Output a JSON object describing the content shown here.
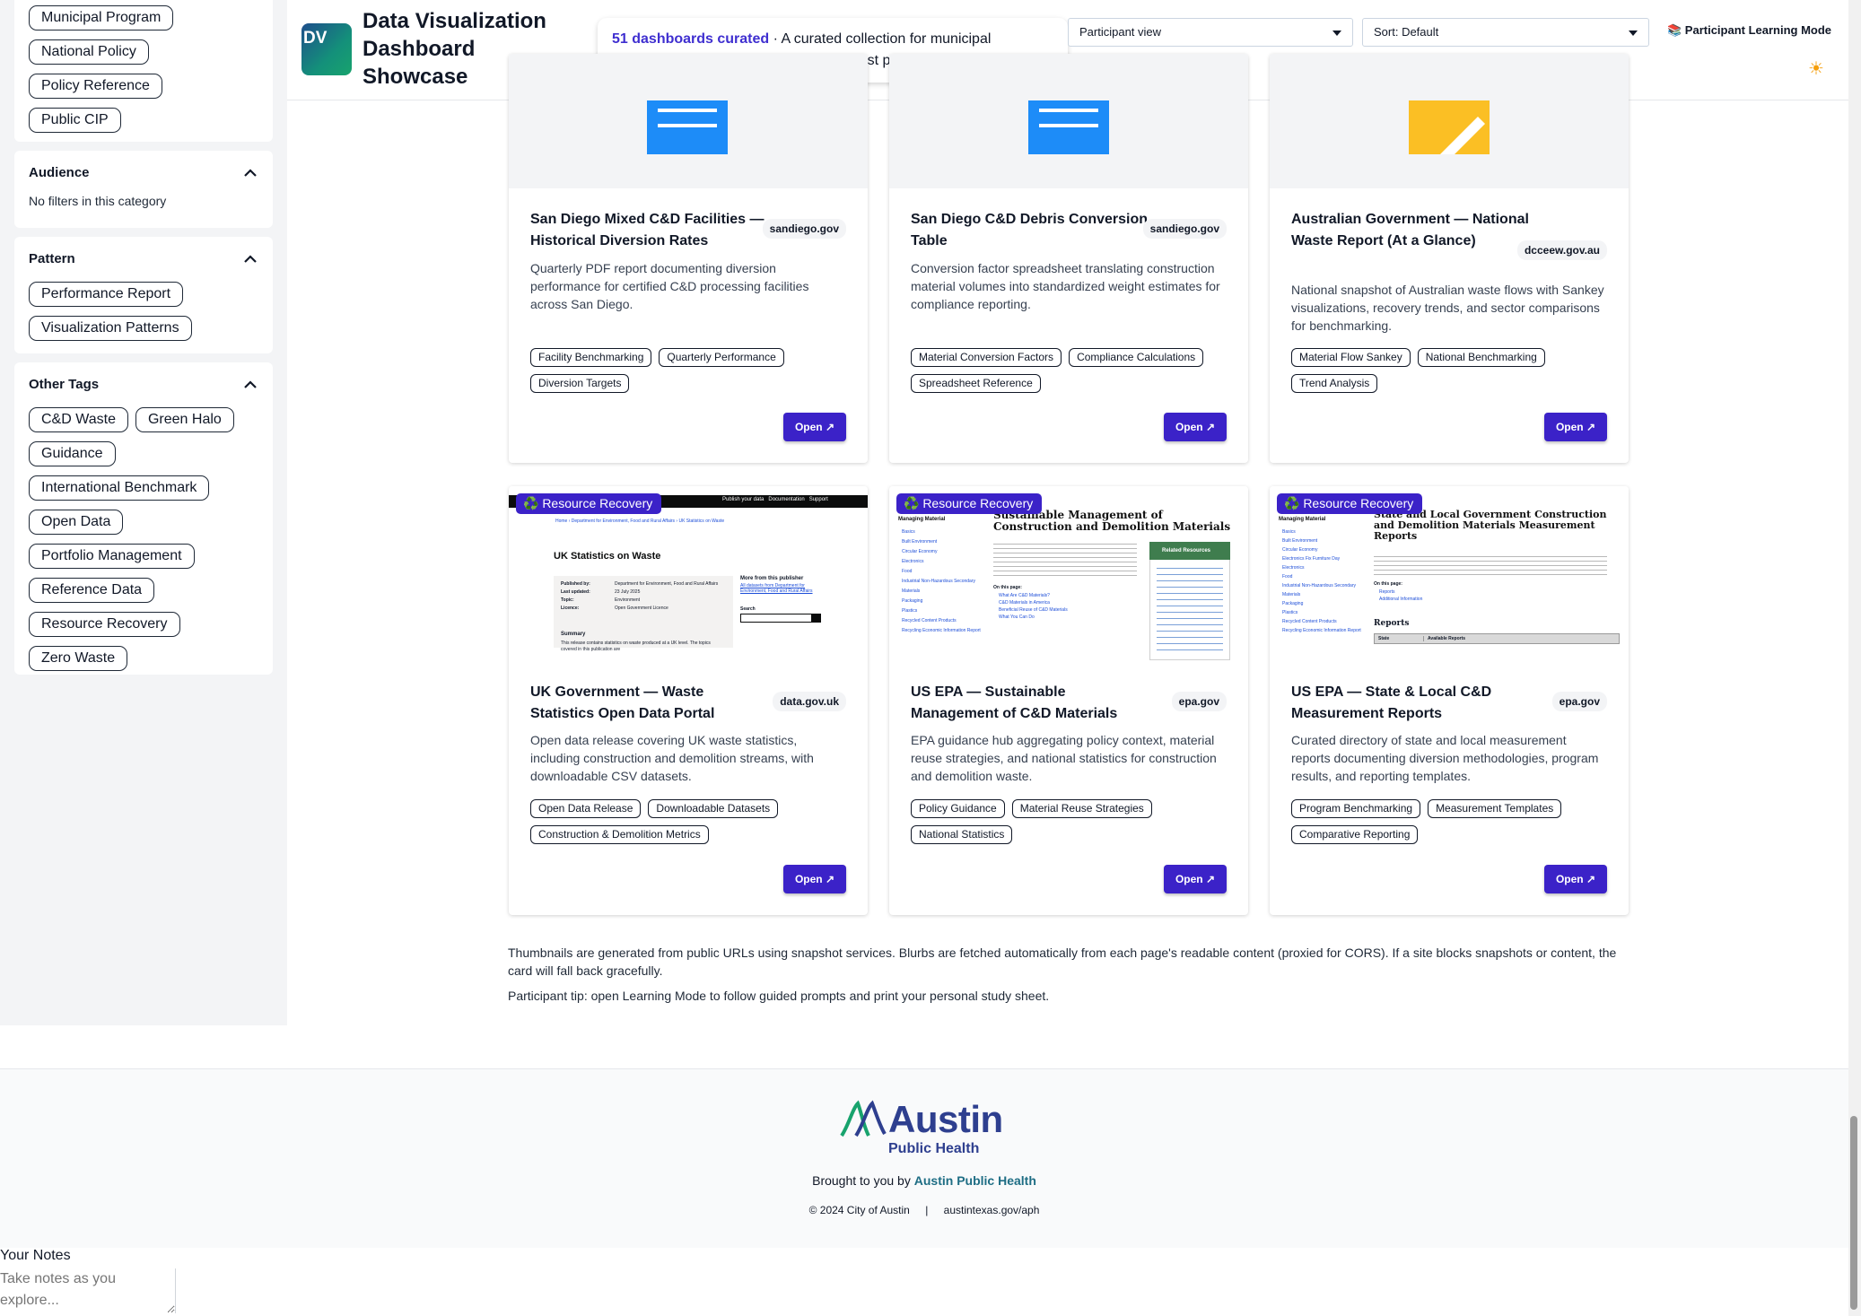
{
  "app": {
    "logo_text": "DV",
    "title": "Data Visualization Dashboard Showcase"
  },
  "summary": {
    "count": "51 dashboards curated",
    "text": " · A curated collection for municipal professionals seeking inspiration and best practices"
  },
  "controls": {
    "view_select": "Participant view",
    "sort_select": "Sort: Default",
    "learning_mode": "📚 Participant Learning Mode",
    "theme_icon": "☀"
  },
  "sidebar": {
    "top_chips": [
      "Municipal Program",
      "National Policy",
      "Policy Reference",
      "Public CIP"
    ],
    "audience": {
      "label": "Audience",
      "empty": "No filters in this category"
    },
    "pattern": {
      "label": "Pattern",
      "chips": [
        "Performance Report",
        "Visualization Patterns"
      ]
    },
    "other_tags": {
      "label": "Other Tags",
      "chips": [
        "C&D Waste",
        "Green Halo",
        "Guidance",
        "International Benchmark",
        "Open Data",
        "Portfolio Management",
        "Reference Data",
        "Resource Recovery",
        "Zero Waste"
      ]
    }
  },
  "cards": [
    {
      "title": "San Diego Mixed C&D Facilities — Historical Diversion Rates",
      "domain": "sandiego.gov",
      "blurb": "Quarterly PDF report documenting diversion performance for certified C&D processing facilities across San Diego.",
      "tags": [
        "Facility Benchmarking",
        "Quarterly Performance",
        "Diversion Targets"
      ],
      "open": "Open ↗"
    },
    {
      "title": "San Diego C&D Debris Conversion Table",
      "domain": "sandiego.gov",
      "blurb": "Conversion factor spreadsheet translating construction material volumes into standardized weight estimates for compliance reporting.",
      "tags": [
        "Material Conversion Factors",
        "Compliance Calculations",
        "Spreadsheet Reference"
      ],
      "open": "Open ↗"
    },
    {
      "title": "Australian Government — National Waste Report (At a Glance)",
      "domain": "dcceew.gov.au",
      "blurb": "National snapshot of Australian waste flows with Sankey visualizations, recovery trends, and sector comparisons for benchmarking.",
      "tags": [
        "Material Flow Sankey",
        "National Benchmarking",
        "Trend Analysis"
      ],
      "open": "Open ↗"
    },
    {
      "badge": "♻️ Resource Recovery",
      "title": "UK Government — Waste Statistics Open Data Portal",
      "domain": "data.gov.uk",
      "blurb": "Open data release covering UK waste statistics, including construction and demolition streams, with downloadable CSV datasets.",
      "tags": [
        "Open Data Release",
        "Downloadable Datasets",
        "Construction & Demolition Metrics"
      ],
      "open": "Open ↗",
      "thumb": {
        "nav": "Publish your data   Documentation   Support",
        "crumb": "Home › Department for Environment, Food and Rural Affairs › UK Statistics on Waste",
        "heading": "UK Statistics on Waste",
        "meta": [
          [
            "Published by:",
            "Department for Environment, Food and Rural Affairs"
          ],
          [
            "Last updated:",
            "23 July 2025"
          ],
          [
            "Topic:",
            "Environment"
          ],
          [
            "Licence:",
            "Open Government Licence"
          ]
        ],
        "summary_label": "Summary",
        "summary_text": "This release contains statistics on waste produced at a UK level. The topics covered in this publication are",
        "more_label": "More from this publisher",
        "more_link": "All datasets from Department for Environment, Food and Rural Affairs",
        "search_label": "Search"
      }
    },
    {
      "badge": "♻️ Resource Recovery",
      "title": "US EPA — Sustainable Management of C&D Materials",
      "domain": "epa.gov",
      "blurb": "EPA guidance hub aggregating policy context, material reuse strategies, and national statistics for construction and demolition waste.",
      "tags": [
        "Policy Guidance",
        "Material Reuse Strategies",
        "National Statistics"
      ],
      "open": "Open ↗",
      "thumb": {
        "side_head": "Managing Material",
        "side_links": [
          "Basics",
          "Built Environment",
          "Circular Economy",
          "Electronics",
          "Food",
          "Industrial Non-Hazardous Secondary Materials",
          "Packaging",
          "Plastics",
          "Recycled Content Products",
          "Recycling Economic Information Report"
        ],
        "heading": "Sustainable Management of Construction and Demolition Materials",
        "related": "Related Resources",
        "page_label": "On this page:",
        "page_links": [
          "What Are C&D Materials?",
          "C&D Materials in America",
          "Beneficial Reuse of C&D Materials",
          "What You Can Do"
        ]
      }
    },
    {
      "badge": "♻️ Resource Recovery",
      "title": "US EPA — State & Local C&D Measurement Reports",
      "domain": "epa.gov",
      "blurb": "Curated directory of state and local measurement reports documenting diversion methodologies, program results, and reporting templates.",
      "tags": [
        "Program Benchmarking",
        "Measurement Templates",
        "Comparative Reporting"
      ],
      "open": "Open ↗",
      "thumb": {
        "side_head": "Managing Material",
        "side_links": [
          "Basics",
          "Built Environment",
          "Circular Economy",
          "Electronics Fix Furniture Day",
          "Electronics",
          "Food",
          "Industrial Non-Hazardous Secondary Materials",
          "Packaging",
          "Plastics",
          "Recycled Content Products",
          "Recycling Economic Information Report"
        ],
        "heading": "State and Local Government Construction and Demolition Materials Measurement Reports",
        "page_label": "On this page:",
        "page_links": [
          "Reports",
          "Additional Information"
        ],
        "reports": "Reports",
        "col1": "State",
        "col2": "Available Reports"
      }
    }
  ],
  "notes": {
    "line1": "Thumbnails are generated from public URLs using snapshot services. Blurbs are fetched automatically from each page's readable content (proxied for CORS). If a site blocks snapshots or content, the card will fall back gracefully.",
    "line2": "Participant tip: open Learning Mode to follow guided prompts and print your personal study sheet."
  },
  "footer": {
    "logo_word": "Austin",
    "logo_sub": "Public Health",
    "brought_prefix": "Brought to you by ",
    "brought_link": "Austin Public Health",
    "copyright": "© 2024 City of Austin",
    "site": "austintexas.gov/aph"
  },
  "user_notes": {
    "label": "Your Notes",
    "placeholder": "Take notes as you explore..."
  },
  "colors": {
    "accent": "#3b22c8",
    "count_text": "#3f2fd0",
    "thumb_blue": "#1d8cf8",
    "thumb_yellow": "#fbbf24",
    "aph_blue": "#2e3f8f",
    "aph_green": "#18a36d"
  },
  "icons": {
    "chevron": "chevron-up-icon",
    "caret": "caret-down-icon",
    "open": "external-link-icon",
    "sun": "sun-icon",
    "books": "books-icon",
    "recycle": "recycle-icon"
  }
}
